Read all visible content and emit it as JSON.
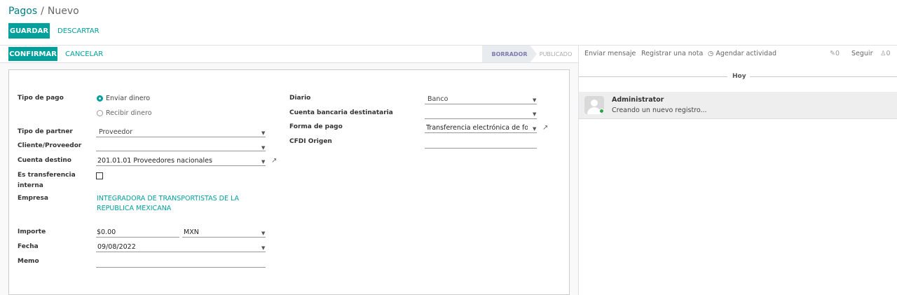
{
  "breadcrumb": {
    "parent": "Pagos",
    "separator": "/",
    "current": "Nuevo"
  },
  "controls": {
    "save": "GUARDAR",
    "discard": "DESCARTAR"
  },
  "header": {
    "confirm": "CONFIRMAR",
    "cancel": "CANCELAR"
  },
  "statusbar": {
    "stages": [
      "BORRADOR",
      "PUBLICADO"
    ],
    "active": "BORRADOR"
  },
  "form": {
    "left": {
      "payment_type": {
        "label": "Tipo de pago",
        "options": [
          "Enviar dinero",
          "Recibir dinero"
        ],
        "selected": "Enviar dinero"
      },
      "partner_type": {
        "label": "Tipo de partner",
        "value": "Proveedor"
      },
      "partner": {
        "label": "Cliente/Proveedor",
        "value": ""
      },
      "destination_account": {
        "label": "Cuenta destino",
        "value": "201.01.01 Proveedores nacionales"
      },
      "internal_transfer": {
        "label_line1": "Es transferencia",
        "label_line2": "interna",
        "checked": false
      },
      "company": {
        "label": "Empresa",
        "value_line1": "INTEGRADORA DE TRANSPORTISTAS DE LA",
        "value_line2": "REPUBLICA MEXICANA"
      },
      "amount": {
        "label": "Importe",
        "value": "$0.00",
        "currency": "MXN"
      },
      "date": {
        "label": "Fecha",
        "value": "09/08/2022"
      },
      "memo": {
        "label": "Memo",
        "value": ""
      }
    },
    "right": {
      "journal": {
        "label": "Diario",
        "value": "Banco"
      },
      "bank_account": {
        "label": "Cuenta bancaria destinataria",
        "value": ""
      },
      "payment_method": {
        "label": "Forma de pago",
        "value": "Transferencia electrónica de fondo"
      },
      "cfdi_origin": {
        "label": "CFDI Origen",
        "value": ""
      }
    }
  },
  "chatter": {
    "send_message": "Enviar mensaje",
    "log_note": "Registrar una nota",
    "schedule_activity": "Agendar actividad",
    "attachments_count": "0",
    "follow": "Seguir",
    "followers_count": "0",
    "date_separator": "Hoy",
    "messages": [
      {
        "author": "Administrator",
        "body": "Creando un nuevo registro..."
      }
    ]
  },
  "colors": {
    "accent": "#00A09D",
    "active_stage_text": "#7c7bad"
  }
}
